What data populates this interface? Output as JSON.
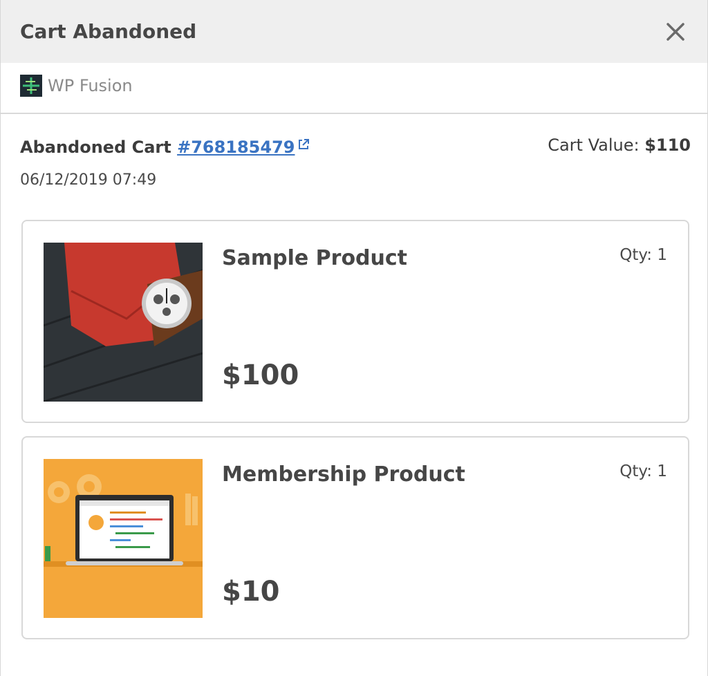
{
  "dialog": {
    "title": "Cart Abandoned"
  },
  "source": {
    "name": "WP Fusion",
    "icon": "wp-fusion-logo-icon"
  },
  "cart": {
    "label": "Abandoned Cart ",
    "id": "#768185479",
    "value_label": "Cart Value: ",
    "value": "$110",
    "date": "06/12/2019 07:49"
  },
  "items": [
    {
      "name": "Sample Product",
      "qty": "Qty: 1",
      "price": "$100",
      "image": "watch-product-image"
    },
    {
      "name": "Membership Product",
      "qty": "Qty: 1",
      "price": "$10",
      "image": "laptop-membership-image"
    }
  ],
  "colors": {
    "header_bg": "#efefef",
    "link": "#3a73c2",
    "card_border": "#d8d8d8",
    "membership_bg": "#f4a73a"
  }
}
